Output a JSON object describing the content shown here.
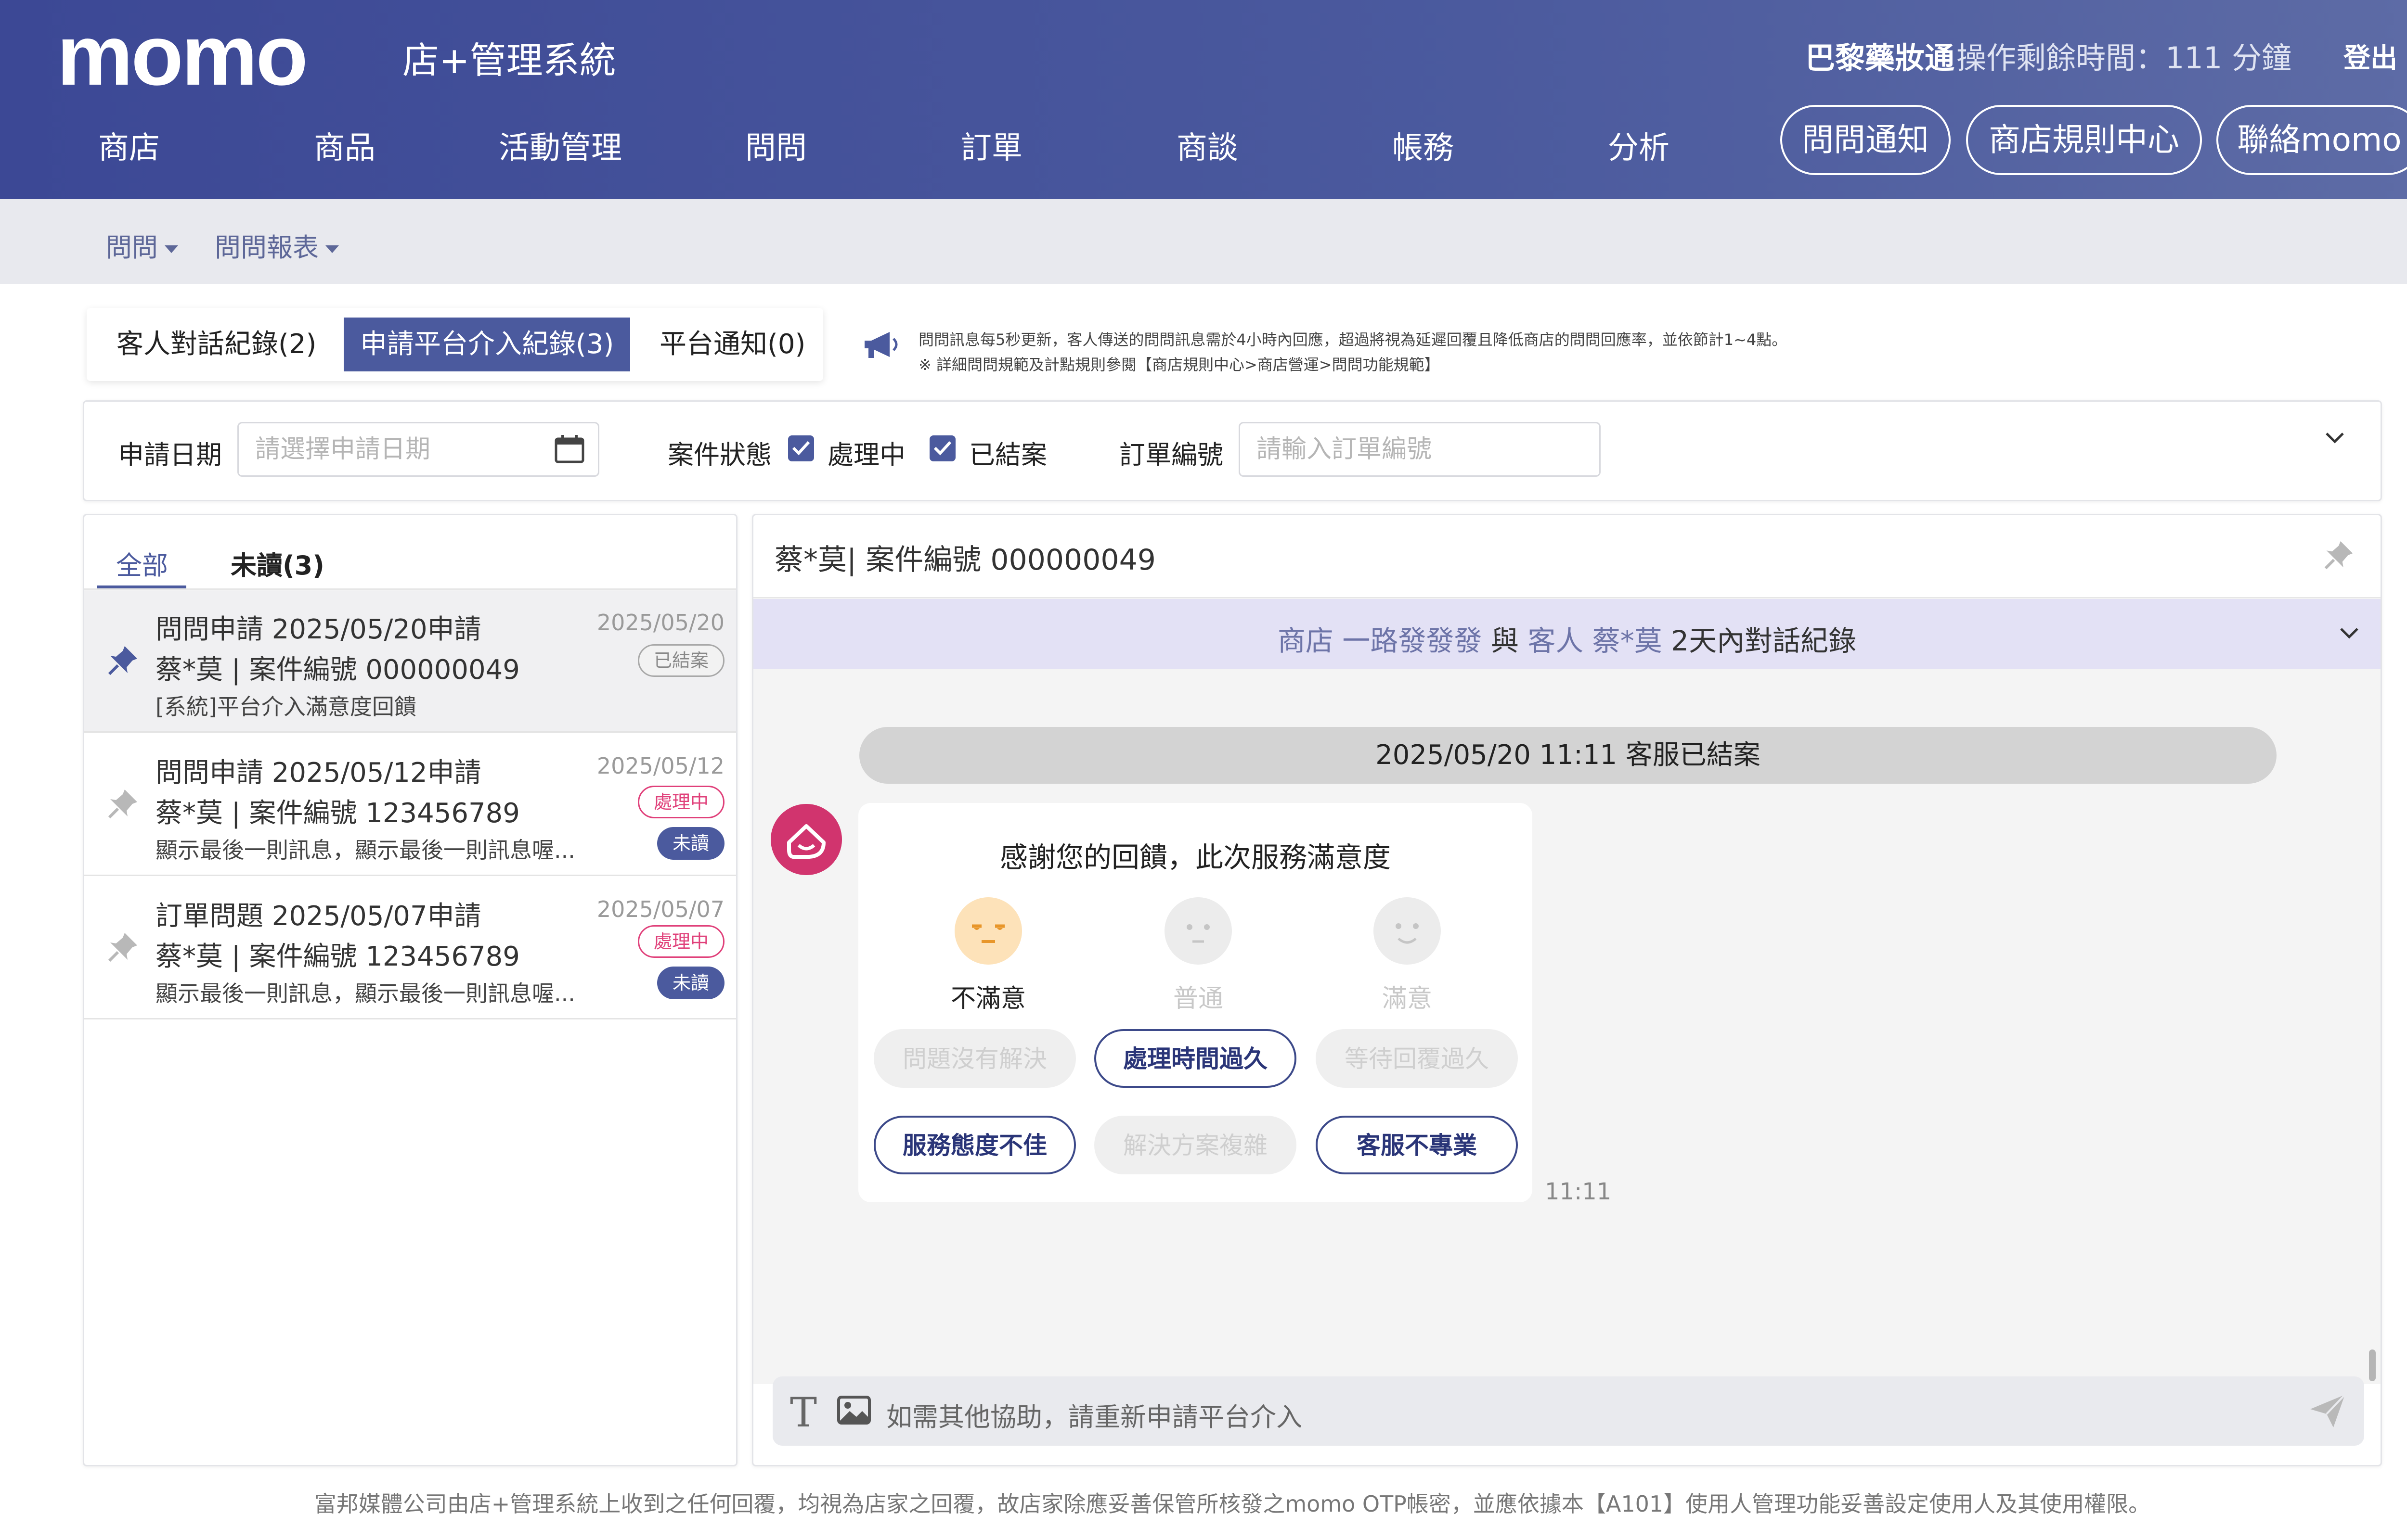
{
  "header": {
    "logo": "momo",
    "subtitle": "店+管理系統",
    "shop_name": "巴黎藥妝通",
    "remaining_time": "操作剩餘時間：111 分鐘",
    "logout": "登出",
    "nav": [
      "商店",
      "商品",
      "活動管理",
      "問問",
      "訂單",
      "商談",
      "帳務",
      "分析"
    ],
    "buttons": [
      "問問通知",
      "商店規則中心",
      "聯絡momo"
    ]
  },
  "subnav": {
    "items": [
      "問問",
      "問問報表"
    ]
  },
  "tabs": {
    "items": [
      "客人對話紀錄(2)",
      "申請平台介入紀錄(3)",
      "平台通知(0)"
    ],
    "active_index": 1
  },
  "notice": {
    "line1": "問問訊息每5秒更新，客人傳送的問問訊息需於4小時內回應，超過將視為延遲回覆且降低商店的問問回應率，並依節計1~4點。",
    "line2": "※ 詳細問問規範及計點規則參閱【商店規則中心>商店營運>問問功能規範】"
  },
  "filter": {
    "date_label": "申請日期",
    "date_placeholder": "請選擇申請日期",
    "status_label": "案件狀態",
    "status_options": [
      {
        "label": "處理中",
        "checked": true
      },
      {
        "label": "已結案",
        "checked": true
      }
    ],
    "order_label": "訂單編號",
    "order_placeholder": "請輸入訂單編號"
  },
  "list": {
    "tabs": [
      "全部",
      "未讀(3)"
    ],
    "items": [
      {
        "title": "問問申請 2025/05/20申請",
        "sub": "蔡*莫 | 案件編號 000000049",
        "preview": "[系統]平台介入滿意度回饋",
        "date": "2025/05/20",
        "status": "已結案",
        "unread": "",
        "pinned": true
      },
      {
        "title": "問問申請 2025/05/12申請",
        "sub": "蔡*莫 | 案件編號 123456789",
        "preview": "顯示最後一則訊息，顯示最後一則訊息喔...",
        "date": "2025/05/12",
        "status": "處理中",
        "unread": "未讀",
        "pinned": false
      },
      {
        "title": "訂單問題 2025/05/07申請",
        "sub": "蔡*莫 | 案件編號 123456789",
        "preview": "顯示最後一則訊息，顯示最後一則訊息喔...",
        "date": "2025/05/07",
        "status": "處理中",
        "unread": "未讀",
        "pinned": false
      }
    ]
  },
  "chat": {
    "title": "蔡*莫| 案件編號 000000049",
    "conv_shop_prefix": "商店",
    "conv_shop_name": "一路發發發",
    "conv_and": "與",
    "conv_customer_prefix": "客人",
    "conv_customer_name": "蔡*莫",
    "conv_suffix": "2天內對話紀錄",
    "system_message": "2025/05/20 11:11 客服已結案",
    "card": {
      "title": "感謝您的回饋，此次服務滿意度",
      "faces": [
        {
          "label": "不滿意",
          "selected": true
        },
        {
          "label": "普通",
          "selected": false
        },
        {
          "label": "滿意",
          "selected": false
        }
      ],
      "chips": [
        {
          "label": "問題沒有解決",
          "selected": false
        },
        {
          "label": "處理時間過久",
          "selected": true
        },
        {
          "label": "等待回覆過久",
          "selected": false
        },
        {
          "label": "服務態度不佳",
          "selected": true
        },
        {
          "label": "解決方案複雜",
          "selected": false
        },
        {
          "label": "客服不專業",
          "selected": true
        }
      ]
    },
    "time": "11:11",
    "composer_placeholder": "如需其他協助，請重新申請平台介入"
  },
  "footer": "富邦媒體公司由店+管理系統上收到之任何回覆，均視為店家之回覆，故店家除應妥善保管所核發之momo OTP帳密，並應依據本【A101】使用人管理功能妥善設定使用人及其使用權限。",
  "colors": {
    "brand": "#4b5a9e",
    "alert": "#e0407a",
    "avatar": "#d1346e"
  }
}
